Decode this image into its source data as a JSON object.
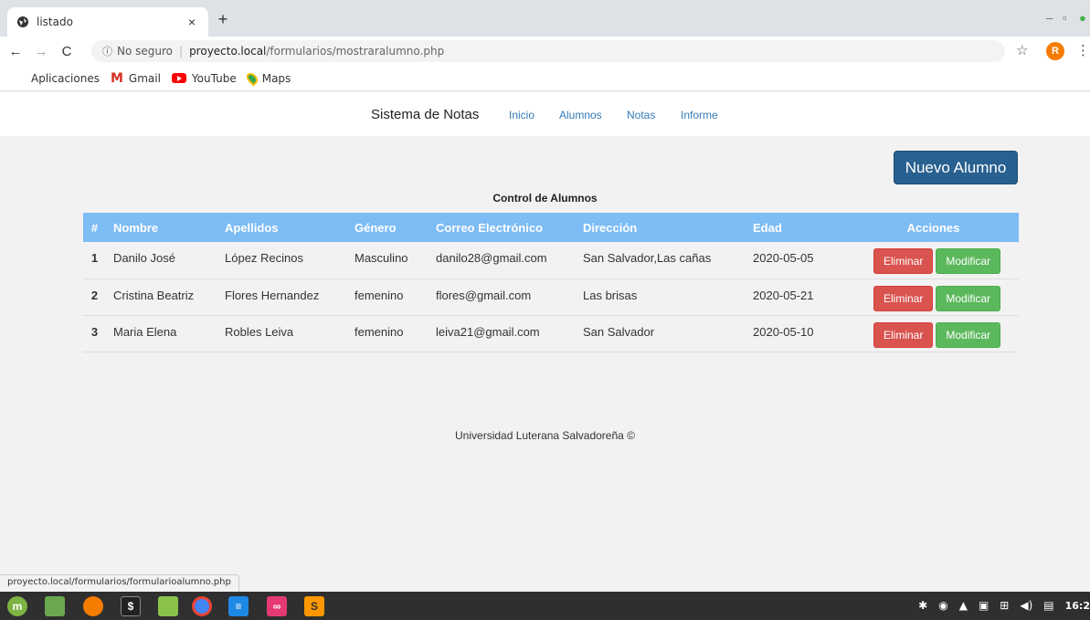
{
  "browser": {
    "tab_title": "listado",
    "tab_close": "×",
    "new_tab": "+",
    "address": {
      "info": "ⓘ",
      "insecure_label": "No seguro",
      "separator": "|",
      "host": "proyecto.local",
      "path": "/formularios/mostraralumno.php"
    },
    "profile_initial": "R",
    "bookmarks": [
      {
        "label": "Aplicaciones",
        "icon": "apps-grid-icon"
      },
      {
        "label": "Gmail",
        "icon": "gmail-icon"
      },
      {
        "label": "YouTube",
        "icon": "youtube-icon"
      },
      {
        "label": "Maps",
        "icon": "maps-icon"
      }
    ],
    "status_url": "proyecto.local/formularios/formularioalumno.php"
  },
  "nav": {
    "brand": "Sistema de Notas",
    "links": [
      "Inicio",
      "Alumnos",
      "Notas",
      "Informe"
    ]
  },
  "main": {
    "new_button": "Nuevo Alumno",
    "table_title": "Control de Alumnos",
    "columns": [
      "#",
      "Nombre",
      "Apellidos",
      "Género",
      "Correo Electrónico",
      "Dirección",
      "Edad",
      "Acciones"
    ],
    "rows": [
      {
        "num": "1",
        "nombre": "Danilo José",
        "apellidos": "López Recinos",
        "genero": "Masculino",
        "correo": "danilo28@gmail.com",
        "direccion": "San Salvador,Las cañas",
        "edad": "2020-05-05"
      },
      {
        "num": "2",
        "nombre": "Cristina Beatriz",
        "apellidos": "Flores Hernandez",
        "genero": "femenino",
        "correo": "flores@gmail.com",
        "direccion": "Las brisas",
        "edad": "2020-05-21"
      },
      {
        "num": "3",
        "nombre": "Maria Elena",
        "apellidos": "Robles Leiva",
        "genero": "femenino",
        "correo": "leiva21@gmail.com",
        "direccion": "San Salvador",
        "edad": "2020-05-10"
      }
    ],
    "delete_label": "Eliminar",
    "modify_label": "Modificar",
    "footer": "Universidad Luterana Salvadoreña ©"
  },
  "taskbar": {
    "clock": "16:2"
  },
  "colors": {
    "primary": "#286090",
    "table_header": "#7dbcf5",
    "danger": "#d9534f",
    "success": "#5cb85c",
    "link": "#337ab7"
  }
}
